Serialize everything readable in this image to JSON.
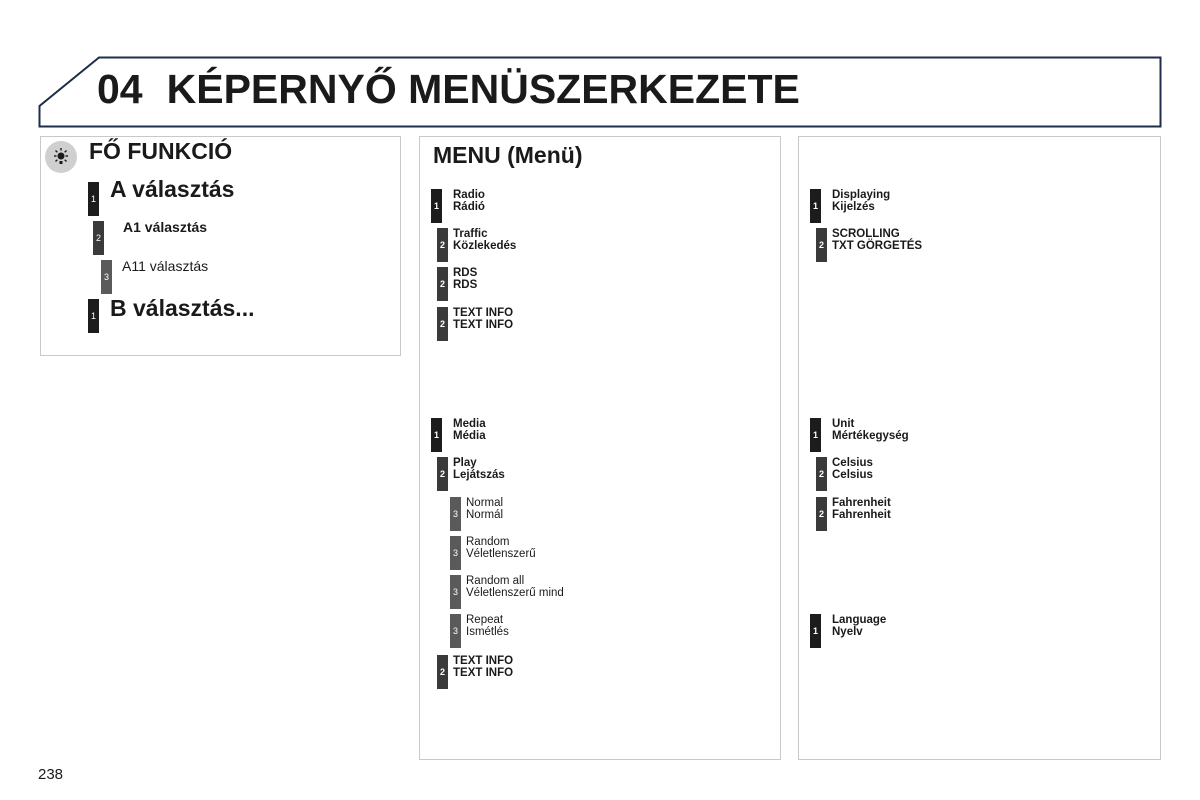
{
  "header": {
    "chapter_number": "04",
    "title": "KÉPERNYŐ MENÜSZERKEZETE"
  },
  "legend": {
    "icon": "main-function-icon",
    "title": "FŐ FUNKCIÓ",
    "items": [
      {
        "level": "1",
        "label": "A választás"
      },
      {
        "level": "2",
        "label": "A1 választás"
      },
      {
        "level": "3",
        "label": "A11 választás"
      },
      {
        "level": "1",
        "label": "B választás..."
      }
    ]
  },
  "menu": {
    "title": "MENU (Menü)",
    "items": [
      {
        "level": "1",
        "en": "Radio",
        "hu": "Rádió"
      },
      {
        "level": "2",
        "en": "Traffic",
        "hu": "Közlekedés"
      },
      {
        "level": "2",
        "en": "RDS",
        "hu": "RDS"
      },
      {
        "level": "2",
        "en": "TEXT INFO",
        "hu": "TEXT INFO"
      },
      {
        "level": "1",
        "en": "Media",
        "hu": "Média"
      },
      {
        "level": "2",
        "en": "Play",
        "hu": "Lejátszás"
      },
      {
        "level": "3",
        "en": "Normal",
        "hu": "Normál"
      },
      {
        "level": "3",
        "en": "Random",
        "hu": "Véletlenszerű"
      },
      {
        "level": "3",
        "en": "Random all",
        "hu": "Véletlenszerű mind"
      },
      {
        "level": "3",
        "en": "Repeat",
        "hu": "Ismétlés"
      },
      {
        "level": "2",
        "en": "TEXT INFO",
        "hu": "TEXT INFO"
      }
    ]
  },
  "right": {
    "items": [
      {
        "level": "1",
        "en": "Displaying",
        "hu": "Kijelzés"
      },
      {
        "level": "2",
        "en": "SCROLLING",
        "hu": "TXT GÖRGETÉS"
      },
      {
        "level": "1",
        "en": "Unit",
        "hu": "Mértékegység"
      },
      {
        "level": "2",
        "en": "Celsius",
        "hu": "Celsius"
      },
      {
        "level": "2",
        "en": "Fahrenheit",
        "hu": "Fahrenheit"
      },
      {
        "level": "1",
        "en": "Language",
        "hu": "Nyelv"
      }
    ]
  },
  "page_number": "238"
}
